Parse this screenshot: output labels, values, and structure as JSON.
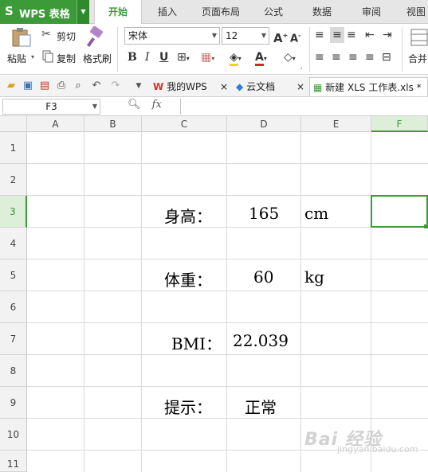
{
  "app": {
    "logo": "S",
    "name": "WPS 表格",
    "dropdown": "▼"
  },
  "tabs": [
    "开始",
    "插入",
    "页面布局",
    "公式",
    "数据",
    "审阅",
    "视图"
  ],
  "ribbon": {
    "paste": "粘贴",
    "cut": "剪切",
    "copy": "复制",
    "format_painter": "格式刷",
    "font": "宋体",
    "font_size": "12",
    "merge": "合并"
  },
  "doc_tabs": [
    {
      "label": "我的WPS",
      "close": "×"
    },
    {
      "label": "云文档",
      "close": "×"
    },
    {
      "label": "新建 XLS 工作表.xls *",
      "close": "×"
    }
  ],
  "formula_bar": {
    "name_box": "F3",
    "fx": "fx",
    "value": ""
  },
  "sheet": {
    "columns": [
      "A",
      "B",
      "C",
      "D",
      "E",
      "F"
    ],
    "selected_column": "F",
    "rows": [
      "1",
      "2",
      "3",
      "4",
      "5",
      "6",
      "7",
      "8",
      "9",
      "10",
      "11"
    ],
    "selected_row": "3",
    "cells": {
      "C3": "身高：",
      "D3": "165",
      "E3": "cm",
      "C5": "体重：",
      "D5": "60",
      "E5": "kg",
      "C7": "BMI：",
      "D7": "22.039",
      "C9": "提示：",
      "D9": "正常"
    }
  },
  "watermark": {
    "text": "Bai 经验",
    "sub": "jingyan.baidu.com"
  },
  "colors": {
    "accent": "#3c9a39",
    "grid": "#dadada"
  }
}
